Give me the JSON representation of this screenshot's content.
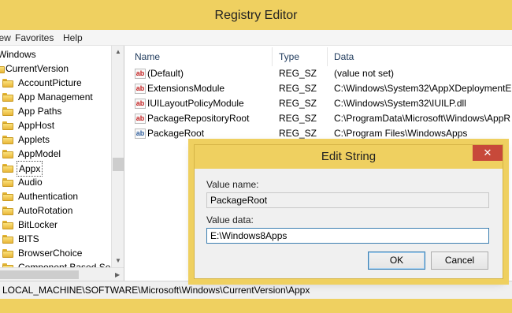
{
  "window": {
    "title": "Registry Editor"
  },
  "menu": [
    {
      "label": "View"
    },
    {
      "label": "Favorites"
    },
    {
      "label": "Help"
    }
  ],
  "tree": {
    "parents": [
      "Windows",
      "CurrentVersion"
    ],
    "items": [
      {
        "label": "AccountPicture"
      },
      {
        "label": "App Management"
      },
      {
        "label": "App Paths"
      },
      {
        "label": "AppHost"
      },
      {
        "label": "Applets"
      },
      {
        "label": "AppModel"
      },
      {
        "label": "Appx"
      },
      {
        "label": "Audio"
      },
      {
        "label": "Authentication"
      },
      {
        "label": "AutoRotation"
      },
      {
        "label": "BitLocker"
      },
      {
        "label": "BITS"
      },
      {
        "label": "BrowserChoice"
      },
      {
        "label": "Component Based Se"
      }
    ],
    "selected": "Appx"
  },
  "list": {
    "headers": {
      "name": "Name",
      "type": "Type",
      "data": "Data"
    },
    "rows": [
      {
        "name": "(Default)",
        "type": "REG_SZ",
        "data": "(value not set)",
        "icon": "string-value-icon"
      },
      {
        "name": "ExtensionsModule",
        "type": "REG_SZ",
        "data": "C:\\Windows\\System32\\AppXDeploymentE",
        "icon": "string-value-icon"
      },
      {
        "name": "IUILayoutPolicyModule",
        "type": "REG_SZ",
        "data": "C:\\Windows\\System32\\IUILP.dll",
        "icon": "string-value-icon"
      },
      {
        "name": "PackageRepositoryRoot",
        "type": "REG_SZ",
        "data": "C:\\ProgramData\\Microsoft\\Windows\\AppR",
        "icon": "string-value-icon"
      },
      {
        "name": "PackageRoot",
        "type": "REG_SZ",
        "data": "C:\\Program Files\\WindowsApps",
        "icon": "string-value-icon"
      }
    ]
  },
  "status": {
    "path": "LOCAL_MACHINE\\SOFTWARE\\Microsoft\\Windows\\CurrentVersion\\Appx"
  },
  "dialog": {
    "title": "Edit String",
    "close_glyph": "✕",
    "value_name_label": "Value name:",
    "value_name": "PackageRoot",
    "value_data_label": "Value data:",
    "value_data": "E:\\Windows8Apps",
    "ok_label": "OK",
    "cancel_label": "Cancel"
  },
  "colors": {
    "frame": "#efd060",
    "close_button": "#c7493a",
    "header_text": "#1e395b"
  }
}
